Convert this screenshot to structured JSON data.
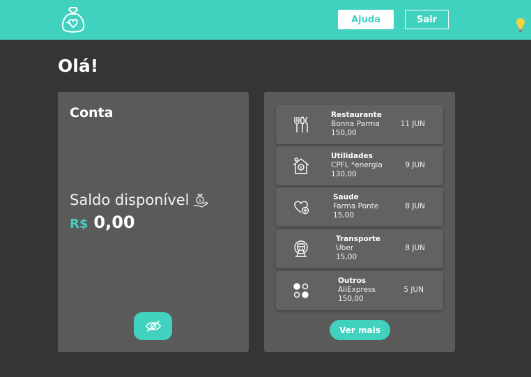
{
  "header": {
    "logo_icon": "money-bag-heart-icon",
    "help_label": "Ajuda",
    "exit_label": "Sair",
    "theme_icon": "lightbulb-icon",
    "accent_color": "#41d2bf"
  },
  "greeting": "Olá!",
  "account": {
    "title": "Conta",
    "balance_label": "Saldo disponível",
    "balance_icon": "money-hand-icon",
    "currency": "R$",
    "amount": "0,00",
    "toggle_icon": "eye-off-icon"
  },
  "transactions": [
    {
      "category": "Restaurante",
      "merchant": "Bonna Parma",
      "amount": "150,00",
      "date": "11 JUN",
      "icon": "cutlery-icon"
    },
    {
      "category": "Utilidades",
      "merchant": "CPFL *energia",
      "amount": "130,00",
      "date": "9 JUN",
      "icon": "house-bill-icon"
    },
    {
      "category": "Saude",
      "merchant": "Farma Ponte",
      "amount": "15,00",
      "date": "8 JUN",
      "icon": "heart-health-icon"
    },
    {
      "category": "Transporte",
      "merchant": "Uber",
      "amount": "15,00",
      "date": "8 JUN",
      "icon": "train-icon"
    },
    {
      "category": "Outros",
      "merchant": "AliExpress",
      "amount": "150,00",
      "date": "5 JUN",
      "icon": "dots-grid-icon"
    }
  ],
  "more_label": "Ver mais"
}
